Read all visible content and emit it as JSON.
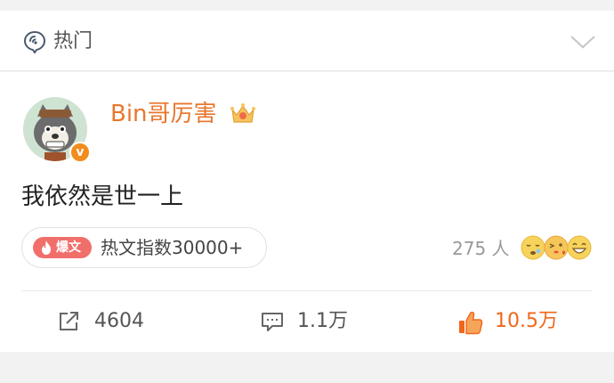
{
  "section": {
    "title": "热门"
  },
  "post": {
    "username": "Bin哥厉害",
    "verified_badge": "v",
    "text": "我依然是世一上"
  },
  "hot": {
    "badge_label": "爆文",
    "index_text": "热文指数30000+"
  },
  "reactions": {
    "people_count": "275 人",
    "emojis": [
      "sleepy-face-icon",
      "kissing-face-icon",
      "grinning-face-icon"
    ]
  },
  "actions": {
    "share_count": "4604",
    "comment_count": "1.1万",
    "like_count": "10.5万"
  },
  "colors": {
    "username": "#e8772e",
    "like_active": "#f0661a",
    "baowen_bg": "#f16f6b",
    "verify_badge": "#f28c1c"
  }
}
